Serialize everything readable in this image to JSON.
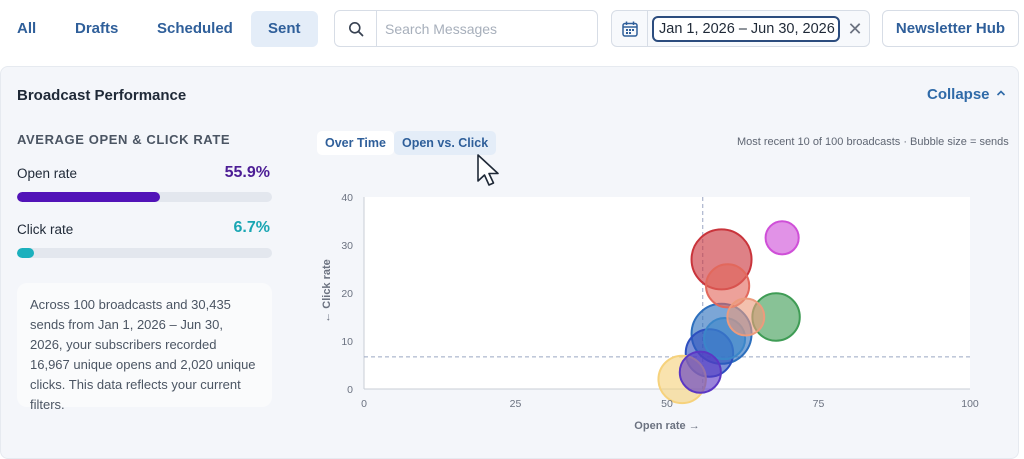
{
  "tabs": [
    {
      "label": "All",
      "active": false
    },
    {
      "label": "Drafts",
      "active": false
    },
    {
      "label": "Scheduled",
      "active": false
    },
    {
      "label": "Sent",
      "active": true
    }
  ],
  "search": {
    "placeholder": "Search Messages",
    "value": ""
  },
  "date_range": {
    "value": "Jan 1, 2026 – Jun 30, 2026"
  },
  "newsletter_hub_label": "Newsletter Hub",
  "panel": {
    "title": "Broadcast Performance",
    "collapse_label": "Collapse",
    "metrics_heading": "AVERAGE OPEN & CLICK RATE",
    "open_rate": {
      "label": "Open rate",
      "value": "55.9%",
      "fraction": 0.559,
      "color": "#5213b8"
    },
    "click_rate": {
      "label": "Click rate",
      "value": "6.7%",
      "fraction": 0.067,
      "color": "#1bb0bd"
    },
    "summary": "Across 100 broadcasts and 30,435 sends from Jan 1, 2026 – Jun 30, 2026, your subscribers recorded 16,967 unique opens and 2,020 unique clicks. This data reflects your current filters.",
    "view_tabs": [
      {
        "label": "Over Time",
        "active": false
      },
      {
        "label": "Open vs. Click",
        "active": true
      }
    ],
    "chart_note": "Most recent 10 of 100 broadcasts · Bubble size = sends"
  },
  "chart_data": {
    "type": "scatter",
    "xlabel": "Open rate →",
    "ylabel": "← Click rate",
    "xlim": [
      0,
      100
    ],
    "ylim": [
      0,
      40
    ],
    "xticks": [
      0,
      25,
      50,
      75,
      100
    ],
    "yticks": [
      0,
      10,
      20,
      30,
      40
    ],
    "reference_lines": {
      "x": 55.9,
      "y": 6.7
    },
    "points": [
      {
        "x": 59,
        "y": 27,
        "size": 1.0,
        "color": "#c9343b"
      },
      {
        "x": 60,
        "y": 21.5,
        "size": 0.6,
        "color": "#e2685c"
      },
      {
        "x": 63,
        "y": 15,
        "size": 0.45,
        "color": "#ec9b7d"
      },
      {
        "x": 68,
        "y": 15,
        "size": 0.7,
        "color": "#3f9c55"
      },
      {
        "x": 69,
        "y": 31.5,
        "size": 0.36,
        "color": "#cf4fd8"
      },
      {
        "x": 59,
        "y": 11.5,
        "size": 1.0,
        "color": "#2c6fbd"
      },
      {
        "x": 59.5,
        "y": 10.5,
        "size": 0.55,
        "color": "#3b86c9"
      },
      {
        "x": 57,
        "y": 7.5,
        "size": 0.7,
        "color": "#2d4fbf"
      },
      {
        "x": 55.5,
        "y": 3.5,
        "size": 0.55,
        "color": "#5b37c4"
      },
      {
        "x": 52.5,
        "y": 2,
        "size": 0.7,
        "color": "#f6d27c"
      }
    ]
  },
  "colors": {
    "accent": "#2f5f9a",
    "panel_bg": "#f4f6fa"
  }
}
